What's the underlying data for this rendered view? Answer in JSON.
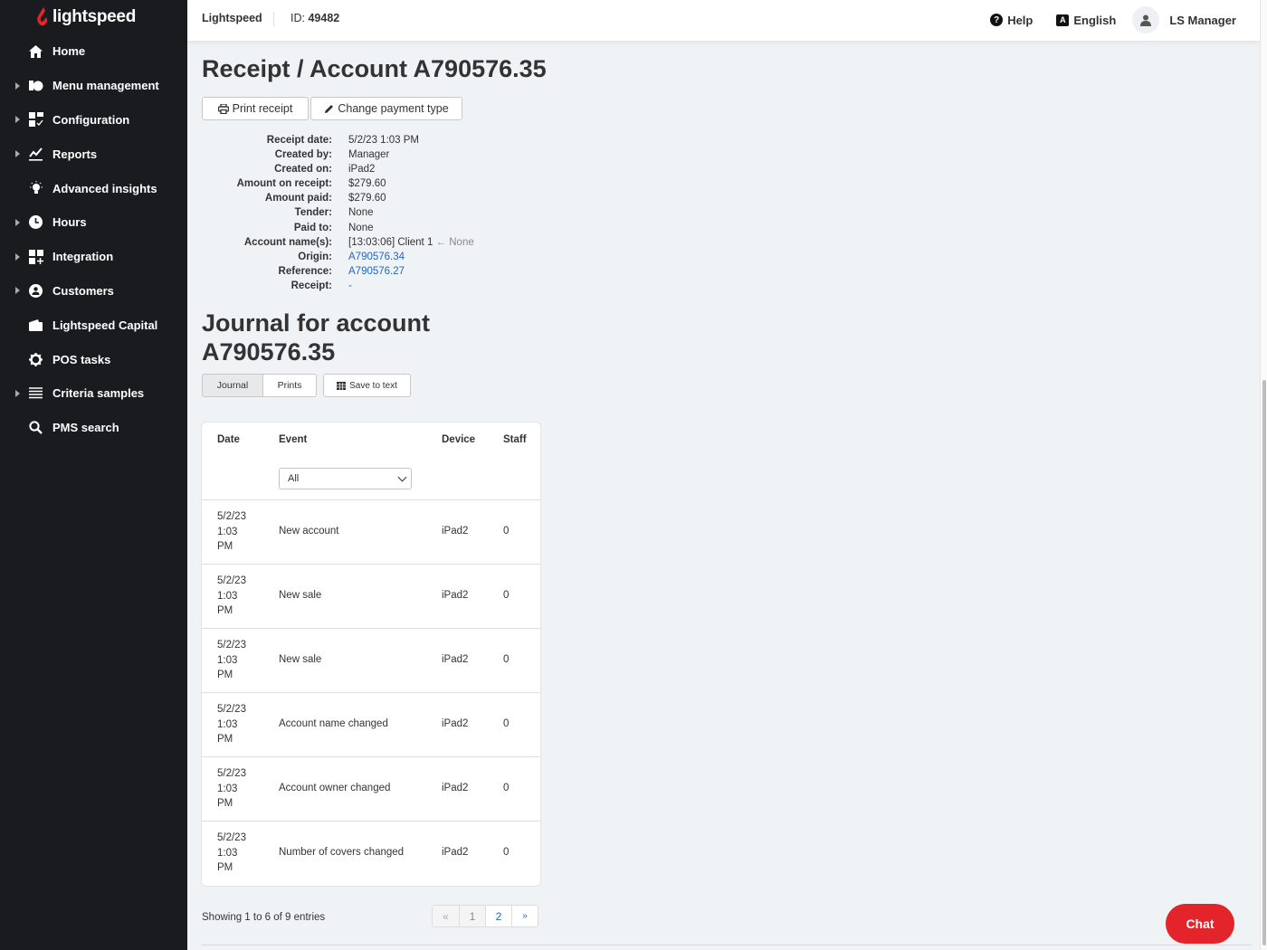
{
  "sidebar": {
    "logo_text": "lightspeed",
    "items": [
      {
        "label": "Home",
        "icon": "home-icon",
        "expandable": false
      },
      {
        "label": "Menu management",
        "icon": "menu-management-icon",
        "expandable": true
      },
      {
        "label": "Configuration",
        "icon": "configuration-icon",
        "expandable": true
      },
      {
        "label": "Reports",
        "icon": "reports-icon",
        "expandable": true
      },
      {
        "label": "Advanced insights",
        "icon": "lightbulb-icon",
        "expandable": false
      },
      {
        "label": "Hours",
        "icon": "clock-icon",
        "expandable": true
      },
      {
        "label": "Integration",
        "icon": "integration-icon",
        "expandable": true
      },
      {
        "label": "Customers",
        "icon": "customer-icon",
        "expandable": true
      },
      {
        "label": "Lightspeed Capital",
        "icon": "wallet-icon",
        "expandable": false
      },
      {
        "label": "POS tasks",
        "icon": "gear-icon",
        "expandable": false
      },
      {
        "label": "Criteria samples",
        "icon": "list-icon",
        "expandable": true
      },
      {
        "label": "PMS search",
        "icon": "search-icon",
        "expandable": false
      }
    ]
  },
  "topbar": {
    "brand": "Lightspeed",
    "id_label": "ID:",
    "id_value": "49482",
    "help": "Help",
    "language": "English",
    "user": "LS Manager"
  },
  "page": {
    "title": "Receipt / Account A790576.35",
    "print_receipt": "Print receipt",
    "change_payment_type": "Change payment type",
    "details": [
      {
        "label": "Receipt date:",
        "value": "5/2/23 1:03 PM"
      },
      {
        "label": "Created by:",
        "value": "Manager"
      },
      {
        "label": "Created on:",
        "value": "iPad2"
      },
      {
        "label": "Amount on receipt:",
        "value": "$279.60"
      },
      {
        "label": "Amount paid:",
        "value": "$279.60"
      },
      {
        "label": "Tender:",
        "value": "None"
      },
      {
        "label": "Paid to:",
        "value": "None"
      },
      {
        "label": "Account name(s):",
        "value": "[13:03:06] Client 1",
        "suffix": "← None"
      },
      {
        "label": "Origin:",
        "value": "A790576.34",
        "link": true
      },
      {
        "label": "Reference:",
        "value": "A790576.27",
        "link": true
      },
      {
        "label": "Receipt:",
        "value": "-",
        "link": true
      }
    ],
    "journal_title": "Journal for account A790576.35",
    "tabs": [
      "Journal",
      "Prints"
    ],
    "active_tab": "Journal",
    "save_to_text": "Save to text"
  },
  "table": {
    "columns": [
      "Date",
      "Event",
      "Device",
      "Staff"
    ],
    "event_filter": "All",
    "rows": [
      {
        "date": [
          "5/2/23",
          "1:03",
          "PM"
        ],
        "event": "New account",
        "device": "iPad2",
        "staff": "0"
      },
      {
        "date": [
          "5/2/23",
          "1:03",
          "PM"
        ],
        "event": "New sale",
        "device": "iPad2",
        "staff": "0"
      },
      {
        "date": [
          "5/2/23",
          "1:03",
          "PM"
        ],
        "event": "New sale",
        "device": "iPad2",
        "staff": "0"
      },
      {
        "date": [
          "5/2/23",
          "1:03",
          "PM"
        ],
        "event": "Account name changed",
        "device": "iPad2",
        "staff": "0"
      },
      {
        "date": [
          "5/2/23",
          "1:03",
          "PM"
        ],
        "event": "Account owner changed",
        "device": "iPad2",
        "staff": "0"
      },
      {
        "date": [
          "5/2/23",
          "1:03",
          "PM"
        ],
        "event": "Number of covers changed",
        "device": "iPad2",
        "staff": "0"
      }
    ]
  },
  "pagination": {
    "summary": "Showing 1 to 6 of 9 entries",
    "prev": "«",
    "pages": [
      "1",
      "2"
    ],
    "current_page": "1",
    "next": "»"
  },
  "chat": {
    "label": "Chat",
    "color": "#e3242b"
  },
  "colors": {
    "sidebar_bg": "#1a1b1f",
    "link": "#2366c7",
    "brand_red": "#e3242b"
  }
}
